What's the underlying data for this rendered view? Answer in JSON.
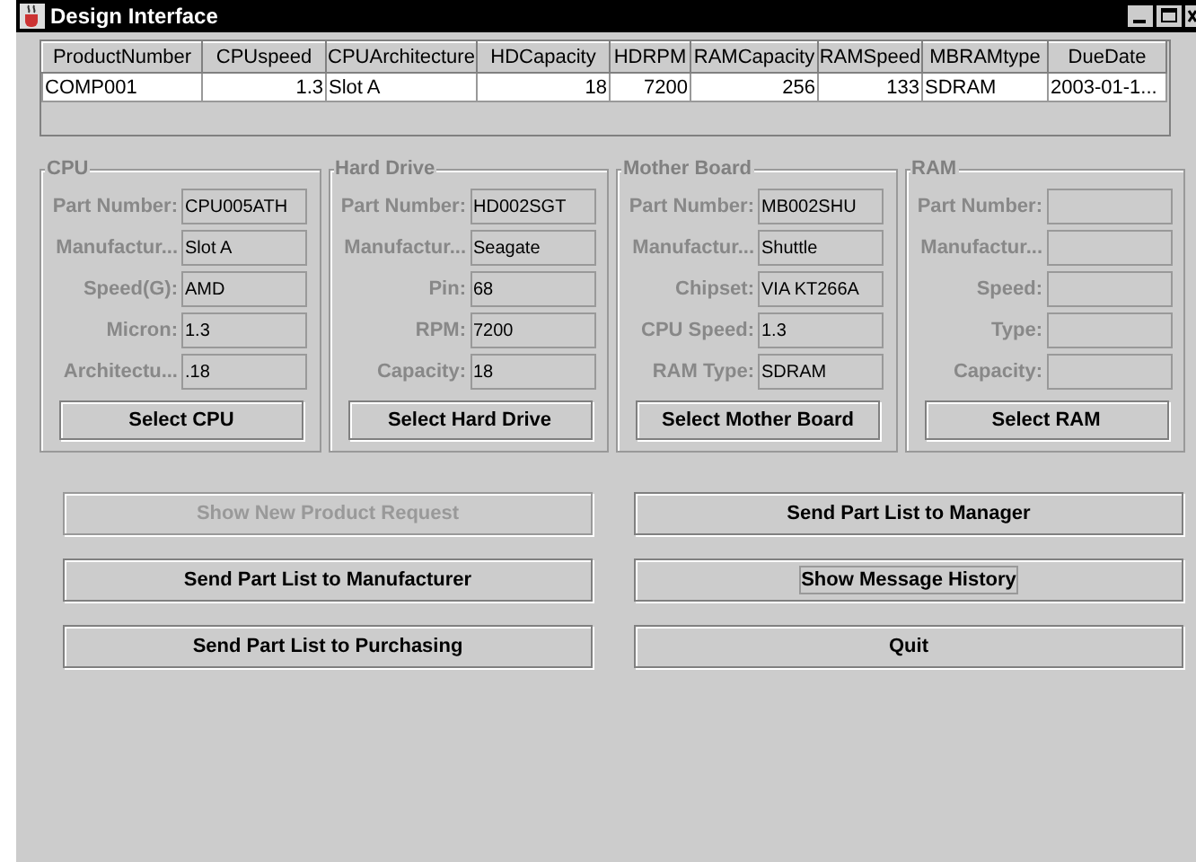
{
  "window": {
    "title": "Design Interface"
  },
  "table": {
    "columns": [
      {
        "label": "ProductNumber",
        "numeric": false
      },
      {
        "label": "CPUspeed",
        "numeric": true
      },
      {
        "label": "CPUArchitecture",
        "numeric": false
      },
      {
        "label": "HDCapacity",
        "numeric": true
      },
      {
        "label": "HDRPM",
        "numeric": true
      },
      {
        "label": "RAMCapacity",
        "numeric": true
      },
      {
        "label": "RAMSpeed",
        "numeric": true
      },
      {
        "label": "MBRAMtype",
        "numeric": false
      },
      {
        "label": "DueDate",
        "numeric": false
      }
    ],
    "rows": [
      {
        "cells": [
          "COMP001",
          "1.3",
          "Slot A",
          "18",
          "7200",
          "256",
          "133",
          "SDRAM",
          "2003-01-1..."
        ]
      }
    ]
  },
  "panels": [
    {
      "title": "CPU",
      "fields": [
        {
          "label": "Part Number:",
          "value": "CPU005ATH"
        },
        {
          "label": "Manufactur...",
          "value": "Slot A"
        },
        {
          "label": "Speed(G):",
          "value": "AMD"
        },
        {
          "label": "Micron:",
          "value": "1.3"
        },
        {
          "label": "Architectu...",
          "value": ".18"
        }
      ],
      "button": "Select CPU"
    },
    {
      "title": "Hard Drive",
      "fields": [
        {
          "label": "Part Number:",
          "value": "HD002SGT"
        },
        {
          "label": "Manufactur...",
          "value": "Seagate"
        },
        {
          "label": "Pin:",
          "value": "68"
        },
        {
          "label": "RPM:",
          "value": "7200"
        },
        {
          "label": "Capacity:",
          "value": "18"
        }
      ],
      "button": "Select Hard Drive"
    },
    {
      "title": "Mother Board",
      "fields": [
        {
          "label": "Part Number:",
          "value": "MB002SHU"
        },
        {
          "label": "Manufactur...",
          "value": "Shuttle"
        },
        {
          "label": "Chipset:",
          "value": "VIA KT266A"
        },
        {
          "label": "CPU Speed:",
          "value": "1.3"
        },
        {
          "label": "RAM Type:",
          "value": "SDRAM"
        }
      ],
      "button": "Select Mother Board"
    },
    {
      "title": "RAM",
      "fields": [
        {
          "label": "Part Number:"
        },
        {
          "label": "Manufactur..."
        },
        {
          "label": "Speed:"
        },
        {
          "label": "Type:"
        },
        {
          "label": "Capacity:"
        }
      ],
      "button": "Select RAM"
    }
  ],
  "actions": [
    {
      "label": "Show New Product Request",
      "disabled": true,
      "focused": false
    },
    {
      "label": "Send Part List to Manager",
      "disabled": false,
      "focused": false
    },
    {
      "label": "Send Part List to Manufacturer",
      "disabled": false,
      "focused": false
    },
    {
      "label": "Show Message History",
      "disabled": false,
      "focused": true
    },
    {
      "label": "Send Part List to Purchasing",
      "disabled": false,
      "focused": false
    },
    {
      "label": "Quit",
      "disabled": false,
      "focused": false
    }
  ]
}
